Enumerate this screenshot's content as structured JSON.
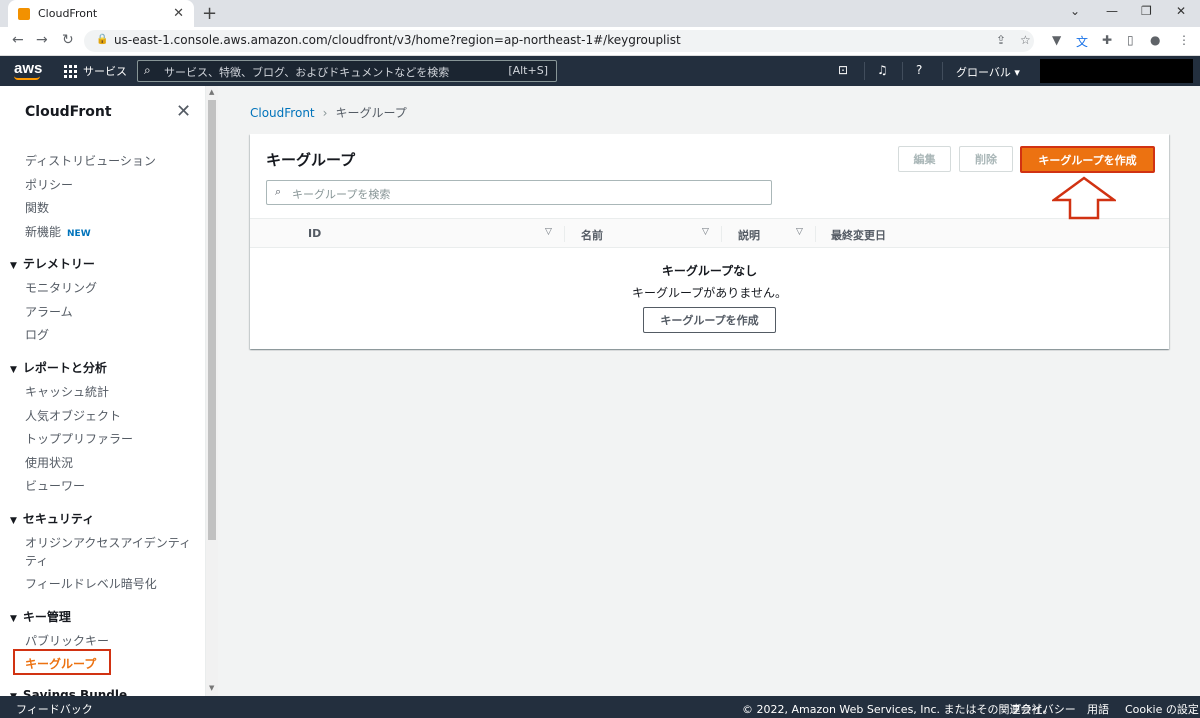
{
  "browser": {
    "tab_title": "CloudFront",
    "tab_close": "✕",
    "new_tab": "+",
    "url": "us-east-1.console.aws.amazon.com/cloudfront/v3/home?region=ap-northeast-1#/keygrouplist",
    "win_min": "⌄",
    "win_minimize": "—",
    "win_restore": "❐",
    "win_close": "✕"
  },
  "awsnav": {
    "logo": "aws",
    "services": "サービス",
    "search_placeholder": "サービス、特徴、ブログ、およびドキュメントなどを検索",
    "search_shortcut": "[Alt+S]",
    "region": "グローバル ▾"
  },
  "sidebar": {
    "title": "CloudFront",
    "items": [
      {
        "label": "ディストリビューション"
      },
      {
        "label": "ポリシー"
      },
      {
        "label": "関数"
      },
      {
        "label": "新機能",
        "badge": "NEW"
      }
    ],
    "telemetry": {
      "title": "テレメトリー",
      "items": [
        "モニタリング",
        "アラーム",
        "ログ"
      ]
    },
    "reports": {
      "title": "レポートと分析",
      "items": [
        "キャッシュ統計",
        "人気オブジェクト",
        "トッププリファラー",
        "使用状況",
        "ビューワー"
      ]
    },
    "security": {
      "title": "セキュリティ",
      "items": [
        "オリジンアクセスアイデンティ",
        "ティ",
        "フィールドレベル暗号化"
      ]
    },
    "keymgmt": {
      "title": "キー管理",
      "items": [
        "パブリックキー",
        "キーグループ"
      ]
    },
    "savings": {
      "title": "Savings Bundle"
    }
  },
  "breadcrumb": {
    "root": "CloudFront",
    "current": "キーグループ"
  },
  "panel": {
    "title": "キーグループ",
    "edit": "編集",
    "delete": "削除",
    "create": "キーグループを作成",
    "search_placeholder": "キーグループを検索",
    "columns": [
      "ID",
      "名前",
      "説明",
      "最終変更日"
    ],
    "empty_title": "キーグループなし",
    "empty_desc": "キーグループがありません。",
    "empty_button": "キーグループを作成"
  },
  "footer": {
    "feedback": "フィードバック",
    "copyright": "© 2022, Amazon Web Services, Inc. またはその関連会社。",
    "privacy": "プライバシー",
    "terms": "用語",
    "cookie": "Cookie の設定"
  },
  "colors": {
    "accent": "#ec7211",
    "highlight": "#d13212",
    "nav": "#232f3e",
    "link": "#0073bb"
  }
}
